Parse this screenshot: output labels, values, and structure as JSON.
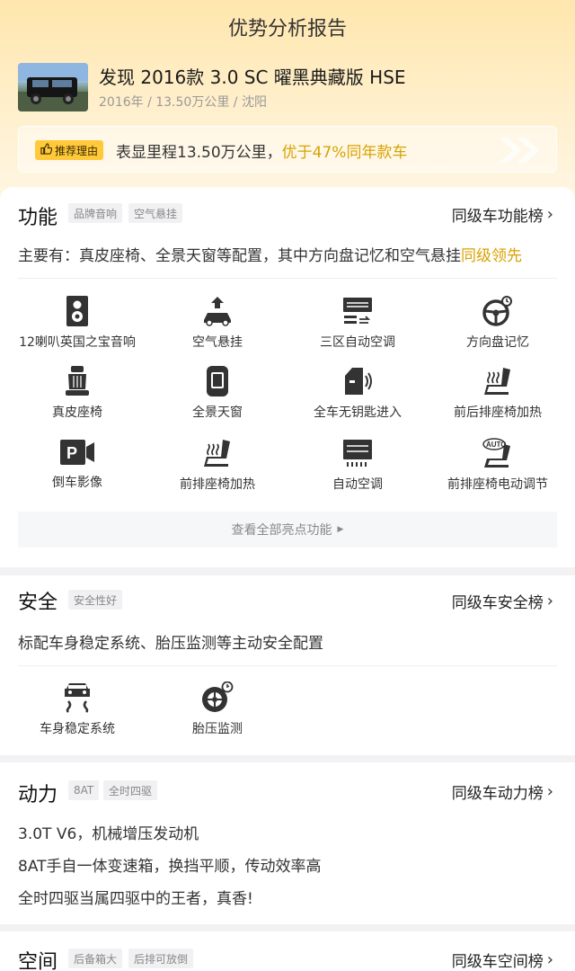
{
  "header": {
    "title": "优势分析报告"
  },
  "car": {
    "name": "发现 2016款 3.0 SC 曜黑典藏版 HSE",
    "meta": "2016年 / 13.50万公里 / 沈阳"
  },
  "reason": {
    "tag": "推荐理由",
    "text": "表显里程13.50万公里，",
    "highlight": "优于47%同年款车"
  },
  "function": {
    "title": "功能",
    "tags": [
      "品牌音响",
      "空气悬挂"
    ],
    "rank_link": "同级车功能榜",
    "summary": "主要有：真皮座椅、全景天窗等配置，其中方向盘记忆和空气悬挂",
    "summary_highlight": "同级领先",
    "features": [
      {
        "icon": "speaker-icon",
        "label": "12喇叭英国之宝音响"
      },
      {
        "icon": "air-suspension-icon",
        "label": "空气悬挂"
      },
      {
        "icon": "climate-zone-icon",
        "label": "三区自动空调"
      },
      {
        "icon": "steering-memory-icon",
        "label": "方向盘记忆"
      },
      {
        "icon": "leather-seat-icon",
        "label": "真皮座椅"
      },
      {
        "icon": "sunroof-icon",
        "label": "全景天窗"
      },
      {
        "icon": "keyless-entry-icon",
        "label": "全车无钥匙进入"
      },
      {
        "icon": "seat-heat-icon",
        "label": "前后排座椅加热"
      },
      {
        "icon": "reverse-camera-icon",
        "label": "倒车影像"
      },
      {
        "icon": "seat-heat-icon",
        "label": "前排座椅加热"
      },
      {
        "icon": "auto-ac-icon",
        "label": "自动空调"
      },
      {
        "icon": "power-seat-icon",
        "label": "前排座椅电动调节"
      }
    ],
    "view_all": "查看全部亮点功能"
  },
  "safety": {
    "title": "安全",
    "tags": [
      "安全性好"
    ],
    "rank_link": "同级车安全榜",
    "summary": "标配车身稳定系统、胎压监测等主动安全配置",
    "features": [
      {
        "icon": "stability-icon",
        "label": "车身稳定系统"
      },
      {
        "icon": "tire-pressure-icon",
        "label": "胎压监测"
      }
    ]
  },
  "power": {
    "title": "动力",
    "tags": [
      "8AT",
      "全时四驱"
    ],
    "rank_link": "同级车动力榜",
    "lines": [
      "3.0T V6，机械增压发动机",
      "8AT手自一体变速箱，换挡平顺，传动效率高",
      "全时四驱当属四驱中的王者，真香!"
    ]
  },
  "space": {
    "title": "空间",
    "tags": [
      "后备箱大",
      "后排可放倒"
    ],
    "rank_link": "同级车空间榜"
  },
  "colors": {
    "accent": "#ffc93a",
    "highlight": "#d9a200",
    "hero_bg": "#ffe6ad"
  }
}
